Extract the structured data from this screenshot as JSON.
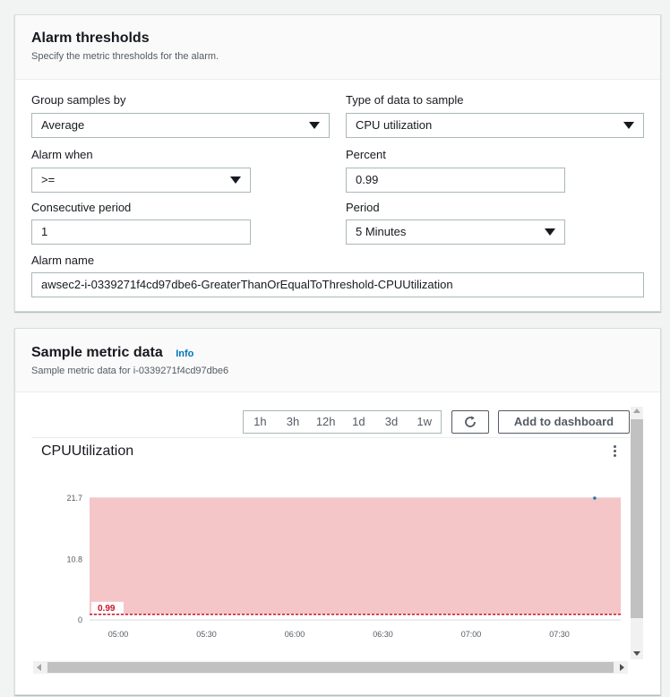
{
  "thresholds": {
    "title": "Alarm thresholds",
    "description": "Specify the metric thresholds for the alarm.",
    "group_samples_by": {
      "label": "Group samples by",
      "value": "Average"
    },
    "type_of_data": {
      "label": "Type of data to sample",
      "value": "CPU utilization"
    },
    "alarm_when": {
      "label": "Alarm when",
      "value": ">="
    },
    "percent": {
      "label": "Percent",
      "value": "0.99"
    },
    "consecutive_period": {
      "label": "Consecutive period",
      "value": "1"
    },
    "period": {
      "label": "Period",
      "value": "5 Minutes"
    },
    "alarm_name": {
      "label": "Alarm name",
      "value": "awsec2-i-0339271f4cd97dbe6-GreaterThanOrEqualToThreshold-CPUUtilization"
    }
  },
  "sample": {
    "title": "Sample metric data",
    "info_link": "Info",
    "description": "Sample metric data for i-0339271f4cd97dbe6",
    "ranges": [
      "1h",
      "3h",
      "12h",
      "1d",
      "3d",
      "1w"
    ],
    "refresh_icon": "refresh-icon",
    "add_to_dashboard": "Add to dashboard"
  },
  "chart_data": {
    "type": "line",
    "title": "CPUUtilization",
    "y_ticks": [
      "21.7",
      "10.8",
      "0"
    ],
    "x_ticks": [
      "05:00",
      "05:30",
      "06:00",
      "06:30",
      "07:00",
      "07:30"
    ],
    "ylim": [
      0,
      21.7
    ],
    "threshold": {
      "value": 0.99,
      "label": "0.99",
      "operator": ">="
    },
    "alarm_region_color": "#f5c6c8",
    "threshold_color": "#c7162b",
    "series": [
      {
        "x": [
          "07:42"
        ],
        "values": [
          21.7
        ],
        "color": "#1f77b4"
      }
    ]
  }
}
